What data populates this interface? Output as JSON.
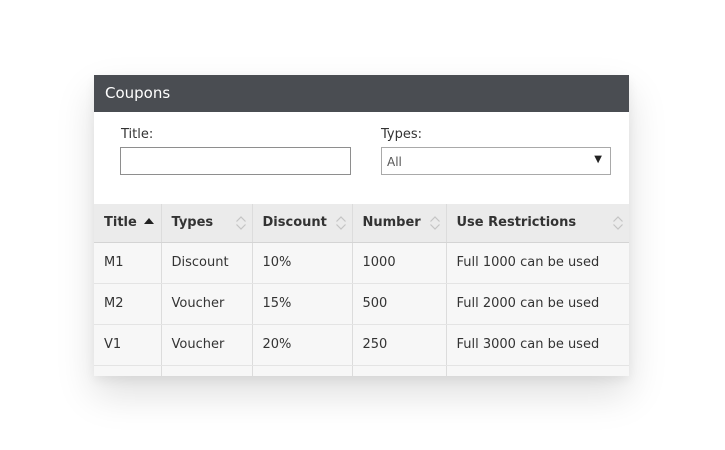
{
  "panel": {
    "title": "Coupons"
  },
  "filters": {
    "title_label": "Title:",
    "title_value": "",
    "types_label": "Types:",
    "types_selected": "All"
  },
  "table": {
    "columns": [
      {
        "label": "Title",
        "sort": "ascending"
      },
      {
        "label": "Types",
        "sort": "none"
      },
      {
        "label": "Discount",
        "sort": "none"
      },
      {
        "label": "Number",
        "sort": "none"
      },
      {
        "label": "Use Restrictions",
        "sort": "none"
      }
    ],
    "rows": [
      [
        "M1",
        "Discount",
        "10%",
        "1000",
        "Full 1000 can be used"
      ],
      [
        "M2",
        "Voucher",
        "15%",
        "500",
        "Full 2000 can be used"
      ],
      [
        "V1",
        "Voucher",
        "20%",
        "250",
        "Full 3000 can be used"
      ]
    ]
  },
  "colors": {
    "header_bar": "#4a4d52",
    "table_header": "#ebebeb",
    "row_background": "#f7f7f7"
  },
  "icons": {
    "sorted": "sort-ascending-icon",
    "unsorted": "sort-both-icon",
    "dropdown": "caret-down-icon"
  }
}
